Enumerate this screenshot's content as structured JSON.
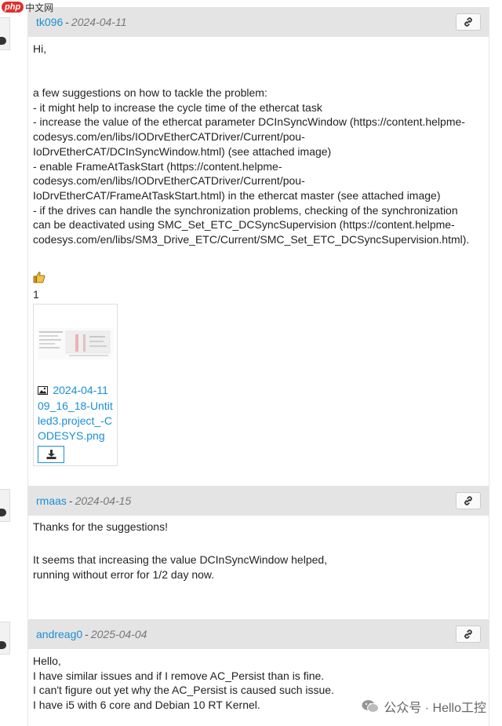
{
  "watermark": {
    "php_label": "php",
    "site_label": "中文网",
    "wechat_text": "公众号 · Hello工控"
  },
  "posts": [
    {
      "author": "tk096",
      "separator": "-",
      "date": "2024-04-11",
      "lines": [
        "Hi,",
        "",
        "a few suggestions on how to tackle the problem:",
        "- it might help to increase the cycle time of the ethercat task",
        "- increase the value of the ethercat parameter DCInSyncWindow (https://content.helpme-",
        "codesys.com/en/libs/IODrvEtherCATDriver/Current/pou-",
        "IoDrvEtherCAT/DCInSyncWindow.html) (see attached image)",
        "- enable FrameAtTaskStart (https://content.helpme-",
        "codesys.com/en/libs/IODrvEtherCATDriver/Current/pou-",
        "IoDrvEtherCAT/FrameAtTaskStart.html) in the ethercat master (see attached image)",
        "- if the drives can handle the synchronization problems, checking of the synchronization",
        "can be deactivated using SMC_Set_ETC_DCSyncSupervision (https://content.helpme-",
        "codesys.com/en/libs/SM3_Drive_ETC/Current/SMC_Set_ETC_DCSyncSupervision.html)."
      ],
      "reaction_count": "1",
      "attachment": {
        "name": "2024-04-11 09_16_18-Untitled3.project_-CODESYS.png"
      }
    },
    {
      "author": "rmaas",
      "separator": "-",
      "date": "2024-04-15",
      "lines": [
        "Thanks for the suggestions!",
        "",
        "It seems that increasing the value DCInSyncWindow helped,",
        "running without error for 1/2 day now."
      ]
    },
    {
      "author": "andreag0",
      "separator": "-",
      "date": "2025-04-04",
      "lines": [
        "Hello,",
        "I have similar issues and if I remove AC_Persist than is fine.",
        "I can't figure out yet why the AC_Persist is caused such issue.",
        "I have i5 with 6 core and Debian 10 RT Kernel."
      ]
    }
  ]
}
